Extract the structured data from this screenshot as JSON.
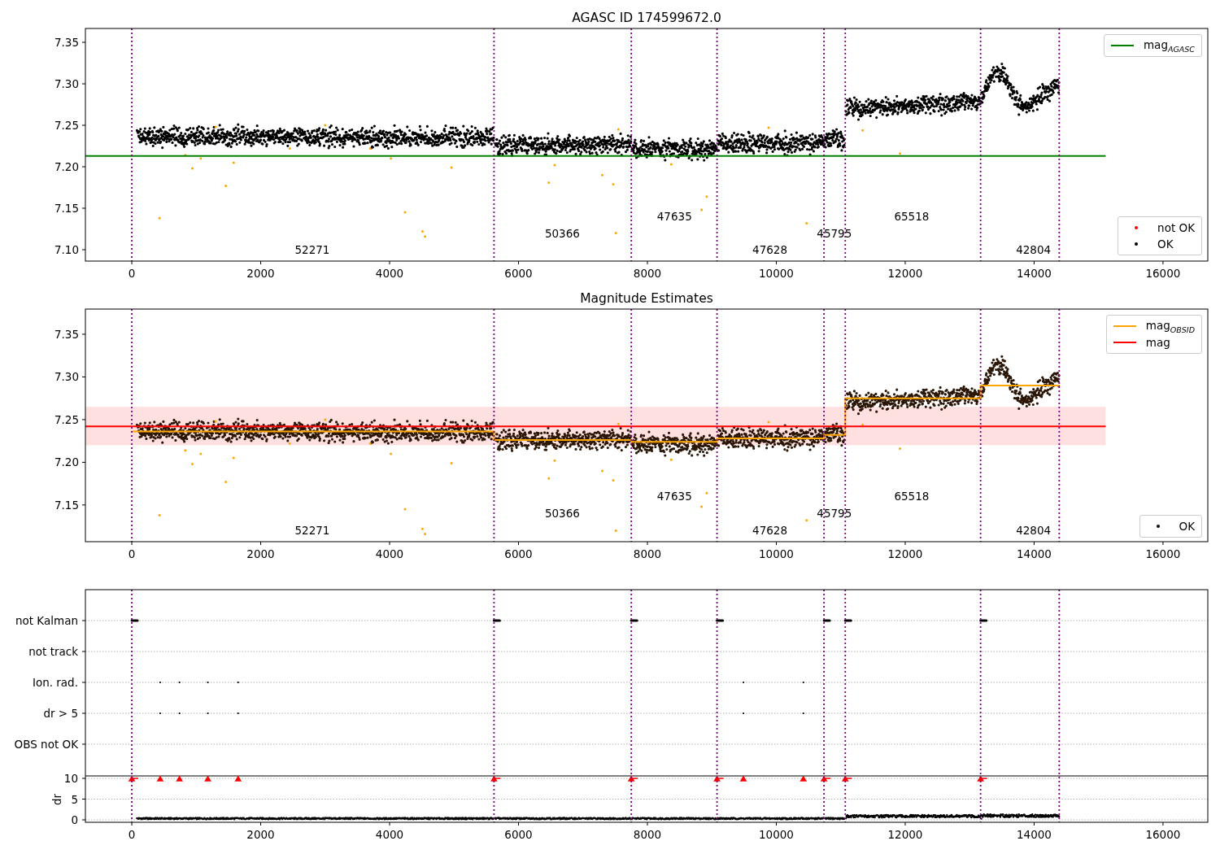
{
  "figure": {
    "panels": [
      {
        "kind": "magnitude",
        "chart_data": {
          "type": "line",
          "title": "AGASC ID 174599672.0",
          "xlim": [
            -720,
            16695
          ],
          "ylim": [
            7.0863,
            7.3667
          ],
          "xticks": [
            0,
            2000,
            4000,
            6000,
            8000,
            10000,
            12000,
            14000,
            16000
          ],
          "yticks": [
            {
              "value": 7.1,
              "label": "7.10"
            },
            {
              "value": 7.15,
              "label": "7.15"
            },
            {
              "value": 7.2,
              "label": "7.20"
            },
            {
              "value": 7.25,
              "label": "7.25"
            },
            {
              "value": 7.3,
              "label": "7.30"
            },
            {
              "value": 7.35,
              "label": "7.35"
            }
          ],
          "series": [
            {
              "name": "mag$_{AGASC}$",
              "color": "#008000",
              "x": [
                -720,
                15110
              ],
              "values": [
                7.213,
                7.213
              ]
            }
          ],
          "ref_lines": [
            {
              "axis": "x",
              "value": 0,
              "color": "#800080"
            },
            {
              "axis": "x",
              "value": 5620,
              "color": "#800080"
            },
            {
              "axis": "x",
              "value": 7750,
              "color": "#800080"
            },
            {
              "axis": "x",
              "value": 9080,
              "color": "#800080"
            },
            {
              "axis": "x",
              "value": 10740,
              "color": "#800080"
            },
            {
              "axis": "x",
              "value": 11070,
              "color": "#800080"
            },
            {
              "axis": "x",
              "value": 13170,
              "color": "#800080"
            },
            {
              "axis": "x",
              "value": 14390,
              "color": "#800080"
            }
          ],
          "annotations": [
            "52271",
            "50366",
            "47635",
            "47628",
            "45795",
            "65518",
            "42804"
          ]
        },
        "marker_legend": [
          {
            "label": "not OK",
            "color": "#ff0000"
          },
          {
            "label": "OK",
            "color": "#000000"
          }
        ]
      },
      {
        "kind": "magnitude",
        "chart_data": {
          "type": "line",
          "title": "Magnitude Estimates",
          "xlim": [
            -720,
            16695
          ],
          "ylim": [
            7.107,
            7.3795
          ],
          "xticks": [
            0,
            2000,
            4000,
            6000,
            8000,
            10000,
            12000,
            14000,
            16000
          ],
          "yticks": [
            {
              "value": 7.15,
              "label": "7.15"
            },
            {
              "value": 7.2,
              "label": "7.20"
            },
            {
              "value": 7.25,
              "label": "7.25"
            },
            {
              "value": 7.3,
              "label": "7.30"
            },
            {
              "value": 7.35,
              "label": "7.35"
            }
          ],
          "series": [
            {
              "name": "mag$_{OBSID}$",
              "color": "#ffa500",
              "x": [
                0,
                5620,
                5620,
                7750,
                7750,
                9080,
                9080,
                10740,
                10740,
                11070,
                11070,
                13170,
                13170,
                14390
              ],
              "values": [
                7.236,
                7.236,
                7.226,
                7.226,
                7.224,
                7.224,
                7.228,
                7.228,
                7.232,
                7.232,
                7.275,
                7.275,
                7.29,
                7.29
              ]
            },
            {
              "name": "mag",
              "color": "#ff0000",
              "x": [
                -720,
                15110
              ],
              "values": [
                7.242,
                7.242
              ]
            }
          ],
          "bands": [
            {
              "axis": "y",
              "from": 7.22,
              "to": 7.265,
              "color": "#ff0000"
            }
          ],
          "ref_lines": [
            {
              "axis": "x",
              "value": 0,
              "color": "#800080"
            },
            {
              "axis": "x",
              "value": 5620,
              "color": "#800080"
            },
            {
              "axis": "x",
              "value": 7750,
              "color": "#800080"
            },
            {
              "axis": "x",
              "value": 9080,
              "color": "#800080"
            },
            {
              "axis": "x",
              "value": 10740,
              "color": "#800080"
            },
            {
              "axis": "x",
              "value": 11070,
              "color": "#800080"
            },
            {
              "axis": "x",
              "value": 13170,
              "color": "#800080"
            },
            {
              "axis": "x",
              "value": 14390,
              "color": "#800080"
            }
          ],
          "annotations": [
            "52271",
            "50366",
            "47635",
            "47628",
            "45795",
            "65518",
            "42804"
          ]
        },
        "marker_legend": [
          {
            "label": "OK",
            "color": "#000000"
          }
        ]
      },
      {
        "kind": "flags",
        "flag_rows": [
          {
            "label": "not Kalman"
          },
          {
            "label": "not track"
          },
          {
            "label": "Ion. rad."
          },
          {
            "label": "dr > 5"
          },
          {
            "label": "OBS not OK"
          }
        ],
        "dr_axis": {
          "label": "dr",
          "ticks": [
            "10",
            "5",
            "0"
          ]
        },
        "xticks": [
          "0",
          "2000",
          "4000",
          "6000",
          "8000",
          "10000",
          "12000",
          "14000",
          "16000"
        ]
      }
    ]
  }
}
